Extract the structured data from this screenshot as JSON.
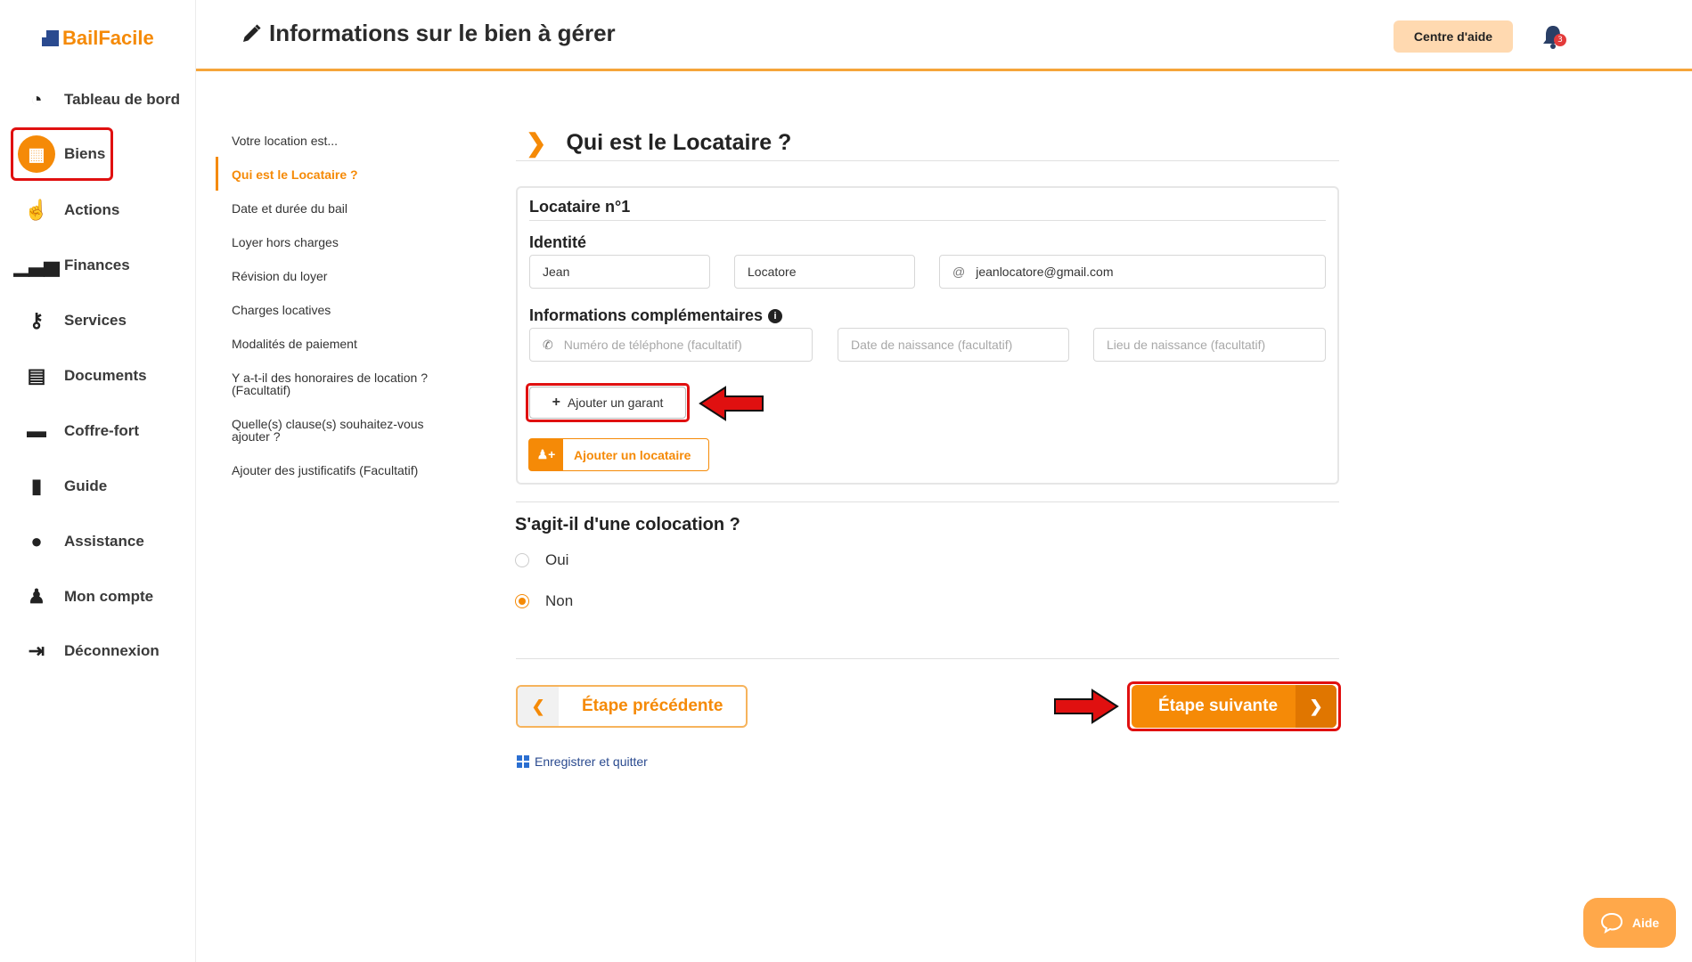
{
  "app": {
    "brand": "BailFacile"
  },
  "sidebar": {
    "items": [
      {
        "label": "Tableau de bord",
        "icon": "dashboard-icon"
      },
      {
        "label": "Biens",
        "icon": "building-icon",
        "active": true
      },
      {
        "label": "Actions",
        "icon": "pointer-hand-icon"
      },
      {
        "label": "Finances",
        "icon": "bar-chart-icon"
      },
      {
        "label": "Services",
        "icon": "key-icon"
      },
      {
        "label": "Documents",
        "icon": "document-icon"
      },
      {
        "label": "Coffre-fort",
        "icon": "archive-box-icon"
      },
      {
        "label": "Guide",
        "icon": "book-icon"
      },
      {
        "label": "Assistance",
        "icon": "chat-bubble-icon"
      },
      {
        "label": "Mon compte",
        "icon": "user-icon"
      },
      {
        "label": "Déconnexion",
        "icon": "logout-icon"
      }
    ]
  },
  "header": {
    "title": "Informations sur le bien à gérer",
    "help_label": "Centre d'aide",
    "notifications_count": "3"
  },
  "steps": [
    {
      "label": "Votre location est..."
    },
    {
      "label": "Qui est le Locataire ?",
      "active": true
    },
    {
      "label": "Date et durée du bail"
    },
    {
      "label": "Loyer hors charges"
    },
    {
      "label": "Révision du loyer"
    },
    {
      "label": "Charges locatives"
    },
    {
      "label": "Modalités de paiement"
    },
    {
      "label": "Y a-t-il des honoraires de location ? (Facultatif)"
    },
    {
      "label": "Quelle(s) clause(s) souhaitez-vous ajouter ?"
    },
    {
      "label": "Ajouter des justificatifs (Facultatif)"
    }
  ],
  "main": {
    "section_title": "Qui est le Locataire ?",
    "tenant": {
      "title": "Locataire n°1",
      "identity_label": "Identité",
      "first_name": "Jean",
      "last_name": "Locatore",
      "email": "jeanlocatore@gmail.com",
      "email_prefix": "@",
      "extra_label": "Informations complémentaires",
      "phone_placeholder": "Numéro de téléphone (facultatif)",
      "birthdate_placeholder": "Date de naissance (facultatif)",
      "birthplace_placeholder": "Lieu de naissance (facultatif)",
      "add_guarantor_label": "Ajouter un garant"
    },
    "add_tenant_label": "Ajouter un locataire",
    "coloc_question": "S'agit-il d'une colocation ?",
    "coloc_options": [
      {
        "label": "Oui",
        "selected": false
      },
      {
        "label": "Non",
        "selected": true
      }
    ],
    "prev_label": "Étape précédente",
    "next_label": "Étape suivante",
    "save_quit_label": "Enregistrer et quitter"
  },
  "help_widget": {
    "label": "Aide"
  },
  "colors": {
    "accent": "#f58a07",
    "highlight": "#e01010",
    "link": "#2a4a8f"
  }
}
